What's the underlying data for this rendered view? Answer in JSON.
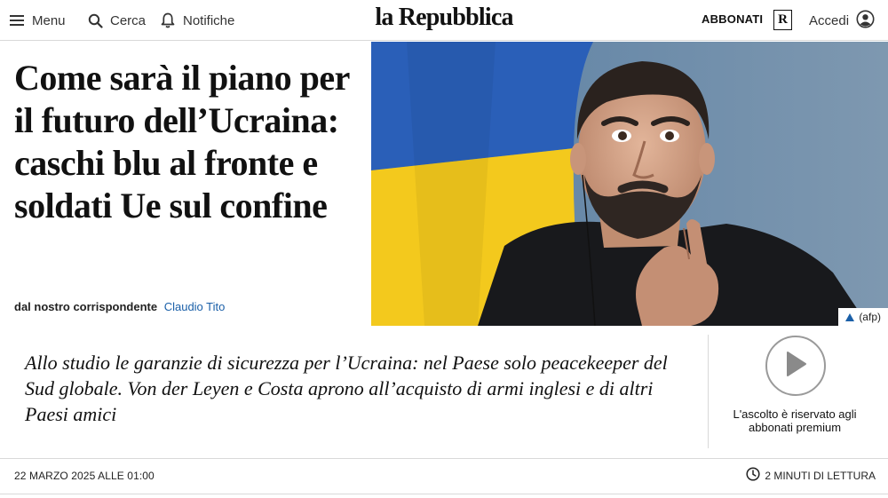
{
  "header": {
    "menu_label": "Menu",
    "search_label": "Cerca",
    "notifications_label": "Notifiche",
    "logo": "la Repubblica",
    "subscribe_label": "ABBONATI",
    "rep_badge": "R",
    "login_label": "Accedi"
  },
  "article": {
    "headline": "Come sarà il piano per il futuro dell’Ucraina: caschi blu al fronte e soldati Ue sul confine",
    "byline_prefix": "dal nostro corrispondente",
    "author": "Claudio Tito",
    "photo_credit": "(afp)",
    "summary": "Allo studio le garanzie di sicurezza per l’Ucraina: nel Paese solo peacekeeper del Sud globale. Von der Leyen e Costa aprono all’acquisto di armi inglesi e di altri Paesi amici",
    "audio_note": "L'ascolto è riservato agli abbonati premium",
    "date": "22 MARZO 2025 ALLE 01:00",
    "reading_time": "2 MINUTI DI LETTURA"
  },
  "icons": {
    "menu": "menu-icon",
    "search": "search-icon",
    "notifications": "bell-icon",
    "account": "user-icon",
    "play": "play-icon",
    "clock": "clock-icon",
    "credit": "triangle-up-icon"
  },
  "colors": {
    "author_link": "#1a5fa8",
    "flag_blue": "#2a5fb8",
    "flag_yellow": "#f3c91d"
  }
}
